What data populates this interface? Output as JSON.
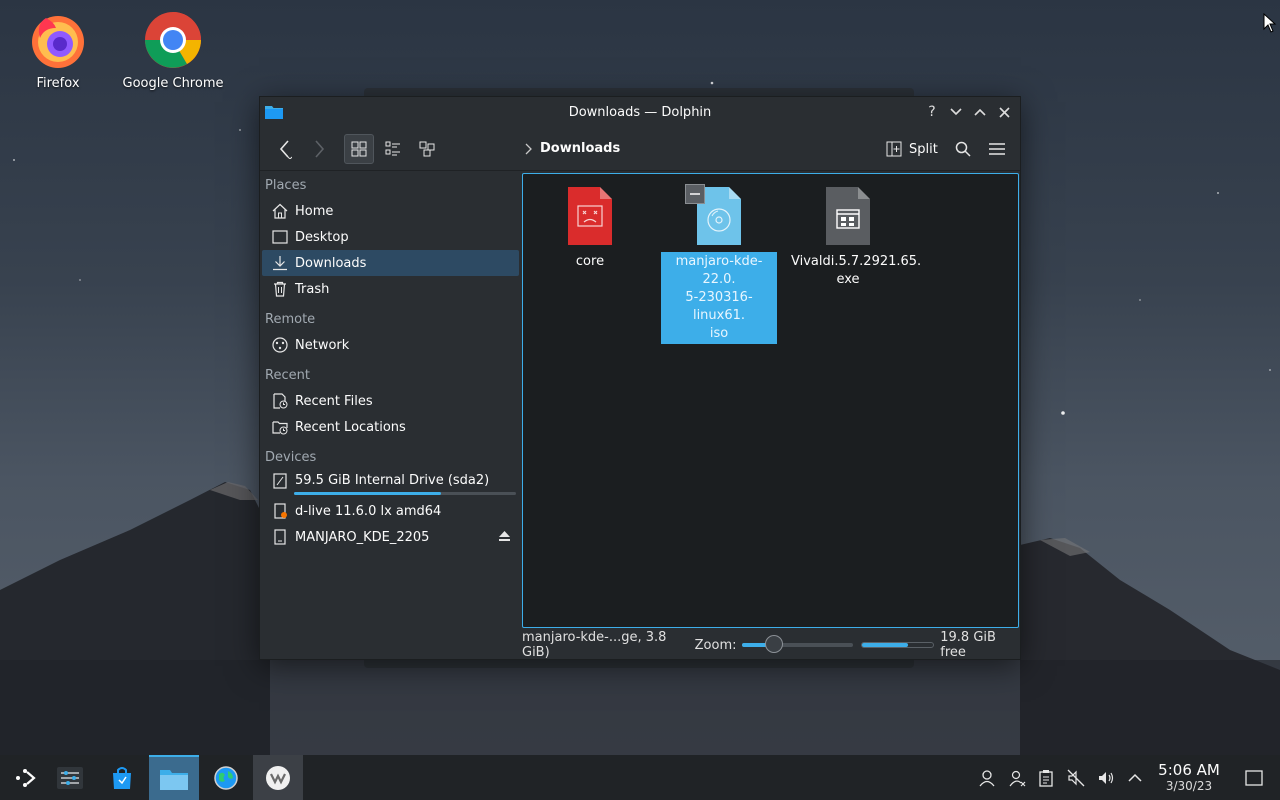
{
  "desktop": {
    "icons": [
      {
        "label": "Firefox"
      },
      {
        "label": "Google Chrome"
      }
    ]
  },
  "window": {
    "title": "Downloads — Dolphin",
    "controls": {
      "help": "?",
      "minimize": "˅",
      "maximize": "˄",
      "close": "×"
    }
  },
  "toolbar": {
    "breadcrumb": "Downloads",
    "split_label": "Split"
  },
  "sidebar": {
    "sections": [
      {
        "title": "Places",
        "items": [
          "Home",
          "Desktop",
          "Downloads",
          "Trash"
        ]
      },
      {
        "title": "Remote",
        "items": [
          "Network"
        ]
      },
      {
        "title": "Recent",
        "items": [
          "Recent Files",
          "Recent Locations"
        ]
      },
      {
        "title": "Devices",
        "items": [
          "59.5 GiB Internal Drive (sda2)",
          "d-live 11.6.0 lx amd64",
          "MANJARO_KDE_2205"
        ]
      }
    ],
    "selected": "Downloads",
    "internal_drive_usage": 0.66
  },
  "files": [
    {
      "name": "core",
      "selected": false,
      "icon": "broken-file-icon",
      "color": "#da2c2c"
    },
    {
      "name": "manjaro-kde-22.0.5-230316-linux61.iso",
      "name_lines": [
        "manjaro-kde-22.0.",
        "5-230316-linux61.",
        "iso"
      ],
      "selected": true,
      "icon": "disc-image-icon",
      "color": "#6ec3ea"
    },
    {
      "name": "Vivaldi.5.7.2921.65.exe",
      "name_lines": [
        "Vivaldi.5.7.2921.65.",
        "exe"
      ],
      "selected": false,
      "icon": "executable-icon",
      "color": "#5a5d61"
    }
  ],
  "statusbar": {
    "selection_text": "manjaro-kde-...ge, 3.8 GiB)",
    "zoom_label": "Zoom:",
    "zoom_level": 0.28,
    "free_space": "19.8 GiB free",
    "free_usage": 0.65
  },
  "taskbar": {
    "clock_time": "5:06 AM",
    "clock_date": "3/30/23"
  },
  "colors": {
    "accent": "#3daee9",
    "window_bg": "#2a2e32",
    "view_bg": "#1b1e20",
    "selection_bg": "#2d4a63"
  }
}
